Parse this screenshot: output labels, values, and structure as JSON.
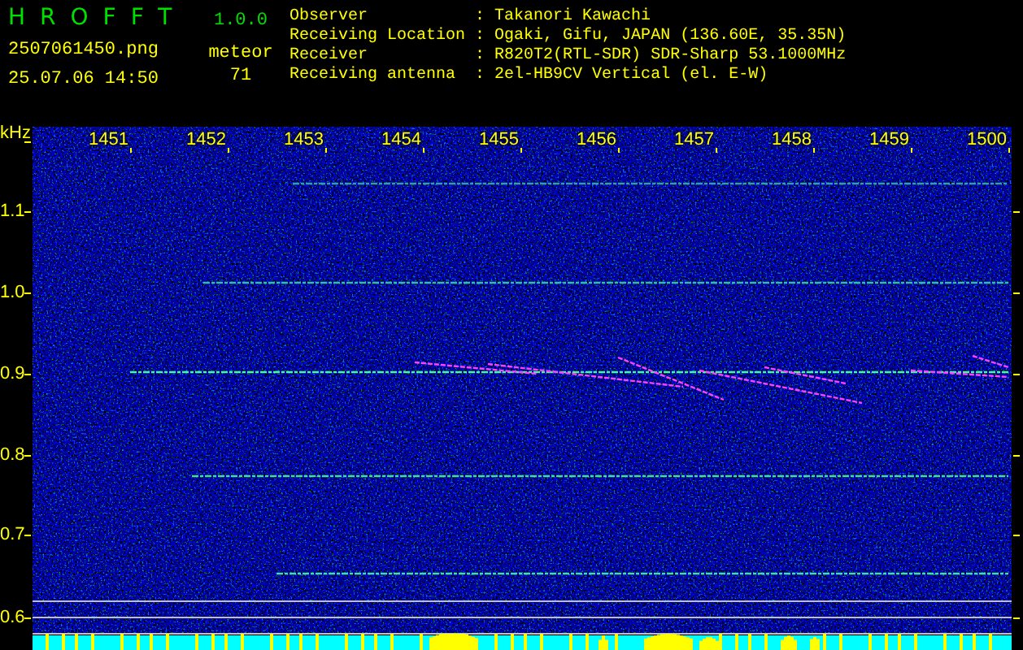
{
  "app": {
    "title": "HROFFT",
    "version": "1.0.0"
  },
  "file": "2507061450.png",
  "timestamp": "25.07.06 14:50",
  "counter": {
    "label": "meteor",
    "value": "71"
  },
  "station_info": [
    {
      "label": "Observer",
      "separator": ":",
      "value": "Takanori Kawachi"
    },
    {
      "label": "Receiving Location",
      "separator": ":",
      "value": "Ogaki, Gifu, JAPAN (136.60E, 35.35N)"
    },
    {
      "label": "Receiver",
      "separator": ":",
      "value": "R820T2(RTL-SDR) SDR-Sharp 53.1000MHz"
    },
    {
      "label": "Receiving antenna",
      "separator": ":",
      "value": "2el-HB9CV Vertical (el. E-W)"
    }
  ],
  "plot": {
    "y_unit": "kHz",
    "y_labels": [
      "1.1",
      "1.0",
      "0.9",
      "0.8",
      "0.7",
      "0.6"
    ],
    "time_labels": [
      "1451",
      "1452",
      "1453",
      "1454",
      "1455",
      "1456",
      "1457",
      "1458",
      "1459",
      "1500"
    ]
  }
}
